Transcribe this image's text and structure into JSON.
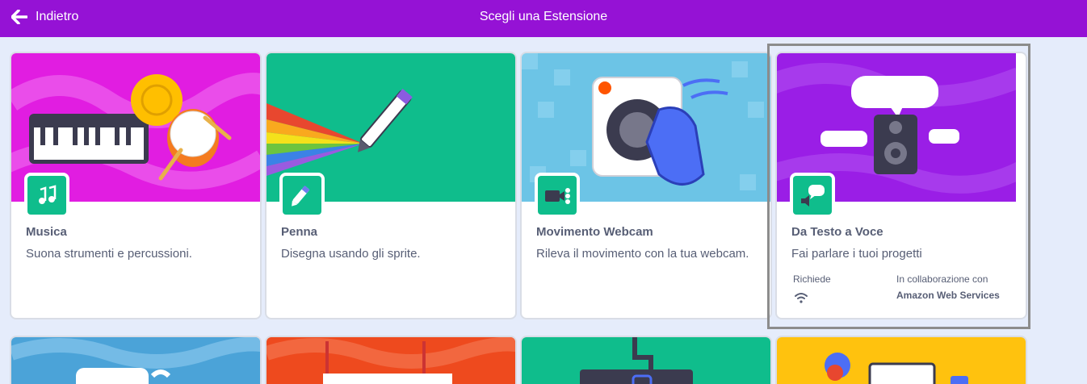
{
  "header": {
    "back_label": "Indietro",
    "title": "Scegli una Estensione"
  },
  "colors": {
    "header": "#9512d5",
    "background": "#e5ecfb",
    "badge_green": "#0fbd8c",
    "text": "#575e75"
  },
  "extensions": [
    {
      "name": "Musica",
      "description": "Suona strumenti e percussioni.",
      "icon": "music-notes-icon",
      "image_bg": "#e11de1"
    },
    {
      "name": "Penna",
      "description": "Disegna usando gli sprite.",
      "icon": "pen-icon",
      "image_bg": "#0fbd8c"
    },
    {
      "name": "Movimento Webcam",
      "description": "Rileva il movimento con la tua webcam.",
      "icon": "video-camera-icon",
      "image_bg": "#6cc4e6"
    },
    {
      "name": "Da Testo a Voce",
      "description": "Fai parlare i tuoi progetti",
      "icon": "speech-icon",
      "image_bg": "#9a1ee6",
      "requires_label": "Richiede",
      "requires_icon": "wifi-icon",
      "collab_label": "In collaborazione con",
      "collab_name": "Amazon Web Services"
    }
  ],
  "second_row_tiles": [
    {
      "image_bg": "#4ba3d8",
      "icon": "translate-icon"
    },
    {
      "image_bg": "#ee4a1e",
      "icon": "makey-makey-icon"
    },
    {
      "image_bg": "#0fbd8c",
      "icon": "microbit-icon"
    },
    {
      "image_bg": "#ffc20e",
      "icon": "lego-robot-icon"
    }
  ]
}
